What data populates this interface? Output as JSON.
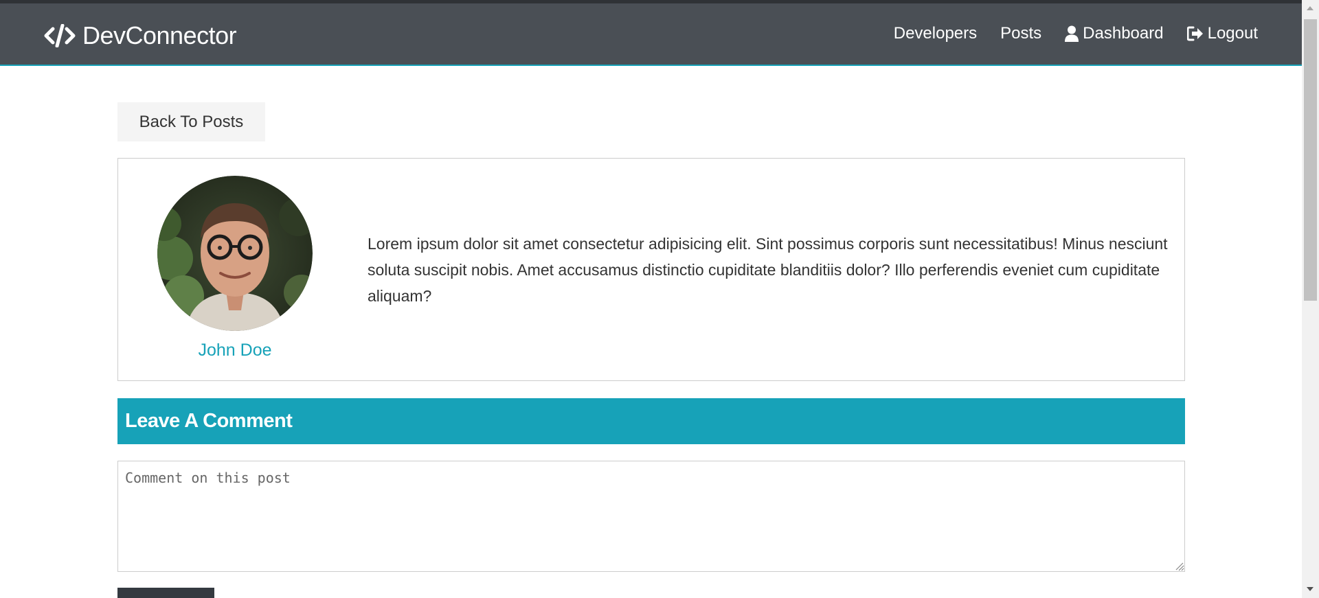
{
  "navbar": {
    "brand": "DevConnector",
    "links": [
      {
        "label": "Developers",
        "icon": ""
      },
      {
        "label": "Posts",
        "icon": ""
      },
      {
        "label": "Dashboard",
        "icon": "user-icon"
      },
      {
        "label": "Logout",
        "icon": "sign-out-icon"
      }
    ]
  },
  "back_button": "Back To Posts",
  "post": {
    "author_name": "John Doe",
    "text": "Lorem ipsum dolor sit amet consectetur adipisicing elit. Sint possimus corporis sunt necessitatibus! Minus nesciunt soluta suscipit nobis. Amet accusamus distinctio cupiditate blanditiis dolor? Illo perferendis eveniet cum cupiditate aliquam?"
  },
  "comment_form": {
    "header": "Leave A Comment",
    "placeholder": "Comment on this post",
    "value": ""
  },
  "colors": {
    "navbar": "#4a4f55",
    "primary": "#17a2b8",
    "light": "#f4f4f4",
    "dark": "#343a40"
  }
}
